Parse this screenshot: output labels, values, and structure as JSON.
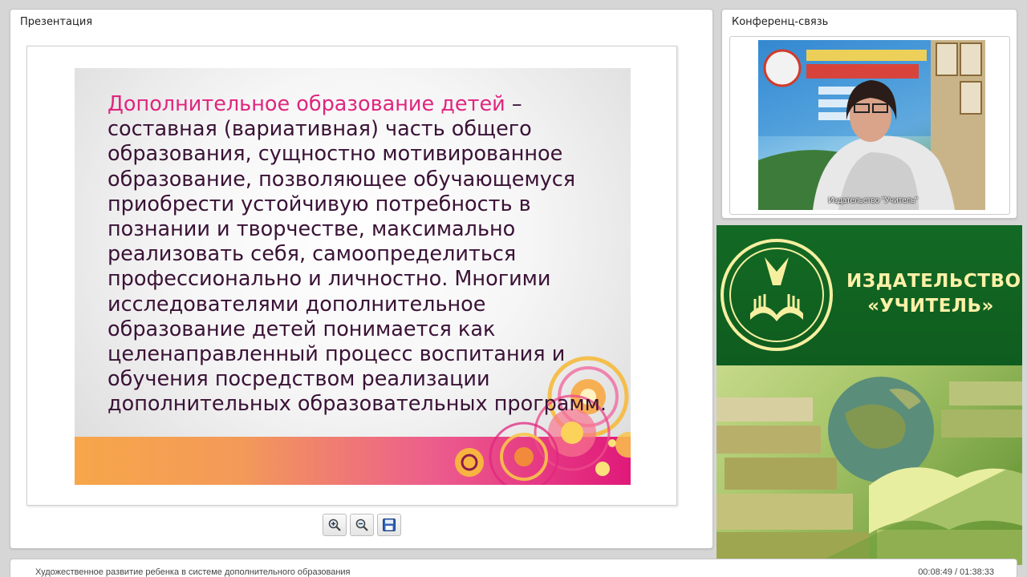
{
  "presentation": {
    "title": "Презентация",
    "slide": {
      "accent_text": "Дополнительное образование детей",
      "body_text": " – составная (вариативная) часть общего образования, сущностно мотивированное образование, позволяющее обучающемуся приобрести устойчивую потребность в познании и творчестве, максимально реализовать себя, самоопределиться профессионально и личностно. Многими исследователями дополнительное образование детей понимается как целенаправленный процесс воспитания и обучения посредством реализации дополнительных образовательных программ."
    },
    "toolbar": {
      "zoom_in_icon": "zoom-in-icon",
      "zoom_out_icon": "zoom-out-icon",
      "save_icon": "save-icon"
    }
  },
  "conference": {
    "title": "Конференц-связь",
    "video_caption": "Издательство \"Учитель\""
  },
  "banner": {
    "publisher_line1": "ИЗДАТЕЛЬСТВО",
    "publisher_line2": "«УЧИТЕЛЬ»"
  },
  "footer": {
    "course_title": "Художественное развитие ребенка в системе дополнительного образования",
    "timecode": "00:08:49 / 01:38:33"
  },
  "colors": {
    "accent_pink": "#e0267f",
    "slide_text": "#3a1236",
    "banner_green": "#136a24",
    "banner_text": "#fff1a8"
  }
}
